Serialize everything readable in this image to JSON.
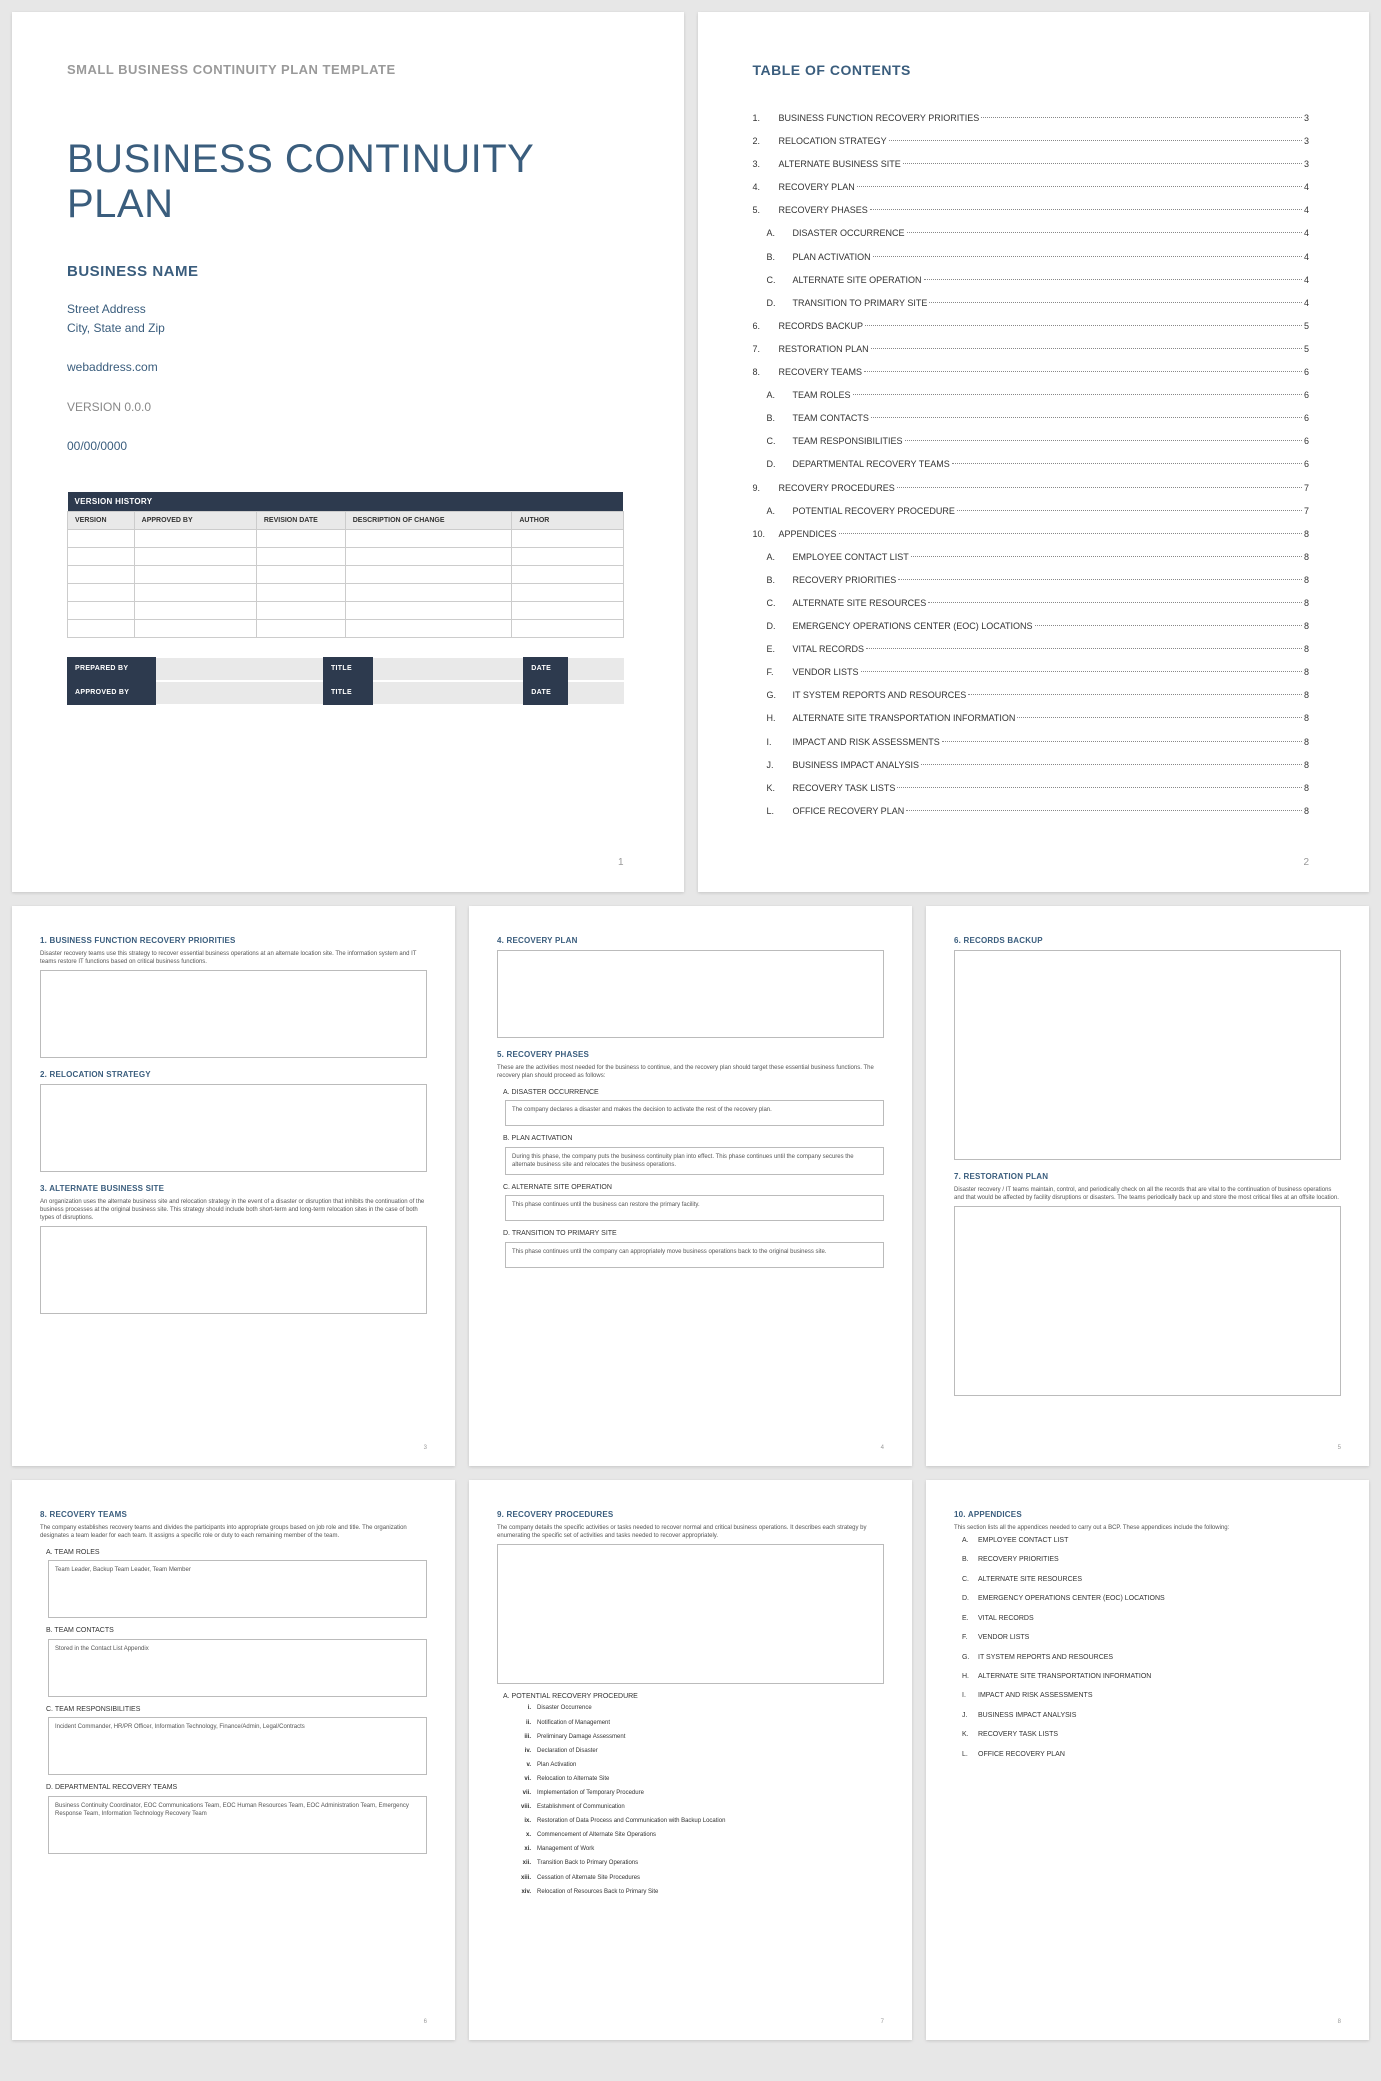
{
  "cover": {
    "template_label": "SMALL BUSINESS CONTINUITY PLAN TEMPLATE",
    "title": "BUSINESS CONTINUITY PLAN",
    "business_name": "BUSINESS NAME",
    "street": "Street Address",
    "city": "City, State and Zip",
    "web": "webaddress.com",
    "version": "VERSION 0.0.0",
    "date": "00/00/0000",
    "vh_header": "VERSION HISTORY",
    "vh_cols": [
      "VERSION",
      "APPROVED BY",
      "REVISION DATE",
      "DESCRIPTION OF CHANGE",
      "AUTHOR"
    ],
    "sign_rows": {
      "prepared": "PREPARED BY",
      "approved": "APPROVED BY",
      "title": "TITLE",
      "date": "DATE"
    },
    "page_num": "1"
  },
  "toc": {
    "title": "TABLE OF CONTENTS",
    "items": [
      {
        "num": "1.",
        "label": "BUSINESS FUNCTION RECOVERY PRIORITIES",
        "page": "3",
        "sub": false
      },
      {
        "num": "2.",
        "label": "RELOCATION STRATEGY",
        "page": "3",
        "sub": false
      },
      {
        "num": "3.",
        "label": "ALTERNATE BUSINESS SITE",
        "page": "3",
        "sub": false
      },
      {
        "num": "4.",
        "label": "RECOVERY PLAN",
        "page": "4",
        "sub": false
      },
      {
        "num": "5.",
        "label": "RECOVERY PHASES",
        "page": "4",
        "sub": false
      },
      {
        "num": "A.",
        "label": "DISASTER OCCURRENCE",
        "page": "4",
        "sub": true
      },
      {
        "num": "B.",
        "label": "PLAN ACTIVATION",
        "page": "4",
        "sub": true
      },
      {
        "num": "C.",
        "label": "ALTERNATE SITE OPERATION",
        "page": "4",
        "sub": true
      },
      {
        "num": "D.",
        "label": "TRANSITION TO PRIMARY SITE",
        "page": "4",
        "sub": true
      },
      {
        "num": "6.",
        "label": "RECORDS BACKUP",
        "page": "5",
        "sub": false
      },
      {
        "num": "7.",
        "label": "RESTORATION PLAN",
        "page": "5",
        "sub": false
      },
      {
        "num": "8.",
        "label": "RECOVERY TEAMS",
        "page": "6",
        "sub": false
      },
      {
        "num": "A.",
        "label": "TEAM ROLES",
        "page": "6",
        "sub": true
      },
      {
        "num": "B.",
        "label": "TEAM CONTACTS",
        "page": "6",
        "sub": true
      },
      {
        "num": "C.",
        "label": "TEAM RESPONSIBILITIES",
        "page": "6",
        "sub": true
      },
      {
        "num": "D.",
        "label": "DEPARTMENTAL RECOVERY TEAMS",
        "page": "6",
        "sub": true
      },
      {
        "num": "9.",
        "label": "RECOVERY PROCEDURES",
        "page": "7",
        "sub": false
      },
      {
        "num": "A.",
        "label": "POTENTIAL RECOVERY PROCEDURE",
        "page": "7",
        "sub": true
      },
      {
        "num": "10.",
        "label": "APPENDICES",
        "page": "8",
        "sub": false
      },
      {
        "num": "A.",
        "label": "EMPLOYEE CONTACT LIST",
        "page": "8",
        "sub": true
      },
      {
        "num": "B.",
        "label": "RECOVERY PRIORITIES",
        "page": "8",
        "sub": true
      },
      {
        "num": "C.",
        "label": "ALTERNATE SITE RESOURCES",
        "page": "8",
        "sub": true
      },
      {
        "num": "D.",
        "label": "EMERGENCY OPERATIONS CENTER (EOC) LOCATIONS",
        "page": "8",
        "sub": true
      },
      {
        "num": "E.",
        "label": "VITAL RECORDS",
        "page": "8",
        "sub": true
      },
      {
        "num": "F.",
        "label": "VENDOR LISTS",
        "page": "8",
        "sub": true
      },
      {
        "num": "G.",
        "label": "IT SYSTEM REPORTS AND RESOURCES",
        "page": "8",
        "sub": true
      },
      {
        "num": "H.",
        "label": "ALTERNATE SITE TRANSPORTATION INFORMATION",
        "page": "8",
        "sub": true
      },
      {
        "num": "I.",
        "label": "IMPACT AND RISK ASSESSMENTS",
        "page": "8",
        "sub": true
      },
      {
        "num": "J.",
        "label": "BUSINESS IMPACT ANALYSIS",
        "page": "8",
        "sub": true
      },
      {
        "num": "K.",
        "label": "RECOVERY TASK LISTS",
        "page": "8",
        "sub": true
      },
      {
        "num": "L.",
        "label": "OFFICE RECOVERY PLAN",
        "page": "8",
        "sub": true
      }
    ],
    "page_num": "2"
  },
  "p3": {
    "s1_title": "1. BUSINESS FUNCTION RECOVERY PRIORITIES",
    "s1_desc": "Disaster recovery teams use this strategy to recover essential business operations at an alternate location site. The information system and IT teams restore IT functions based on critical business functions.",
    "s2_title": "2. RELOCATION STRATEGY",
    "s3_title": "3. ALTERNATE BUSINESS SITE",
    "s3_desc": "An organization uses the alternate business site and relocation strategy in the event of a disaster or disruption that inhibits the continuation of the business processes at the original business site. This strategy should include both short-term and long-term relocation sites in the case of both types of disruptions.",
    "page_num": "3"
  },
  "p4": {
    "s4_title": "4. RECOVERY PLAN",
    "s5_title": "5. RECOVERY PHASES",
    "s5_desc": "These are the activities most needed for the business to continue, and the recovery plan should target these essential business functions. The recovery plan should proceed as follows:",
    "a_title": "A. DISASTER OCCURRENCE",
    "a_box": "The company declares a disaster and makes the decision to activate the rest of the recovery plan.",
    "b_title": "B. PLAN ACTIVATION",
    "b_box": "During this phase, the company puts the business continuity plan into effect. This phase continues until the company secures the alternate business site and relocates the business operations.",
    "c_title": "C. ALTERNATE SITE OPERATION",
    "c_box": "This phase continues until the business can restore the primary facility.",
    "d_title": "D. TRANSITION TO PRIMARY SITE",
    "d_box": "This phase continues until the company can appropriately move business operations back to the original business site.",
    "page_num": "4"
  },
  "p5": {
    "s6_title": "6. RECORDS BACKUP",
    "s7_title": "7. RESTORATION PLAN",
    "s7_desc": "Disaster recovery / IT teams maintain, control, and periodically check on all the records that are vital to the continuation of business operations and that would be affected by facility disruptions or disasters. The teams periodically back up and store the most critical files at an offsite location.",
    "page_num": "5"
  },
  "p6": {
    "s8_title": "8. RECOVERY TEAMS",
    "s8_desc": "The company establishes recovery teams and divides the participants into appropriate groups based on job role and title. The organization designates a team leader for each team. It assigns a specific role or duty to each remaining member of the team.",
    "a_title": "A. TEAM ROLES",
    "a_box": "Team Leader, Backup Team Leader, Team Member",
    "b_title": "B. TEAM CONTACTS",
    "b_box": "Stored in the Contact List Appendix",
    "c_title": "C. TEAM RESPONSIBILITIES",
    "c_box": "Incident Commander, HR/PR Officer, Information Technology, Finance/Admin, Legal/Contracts",
    "d_title": "D. DEPARTMENTAL RECOVERY TEAMS",
    "d_box": "Business Continuity Coordinator, EOC Communications Team, EOC Human Resources Team, EOC Administration Team, Emergency Response Team, Information Technology Recovery Team",
    "page_num": "6"
  },
  "p7": {
    "s9_title": "9. RECOVERY PROCEDURES",
    "s9_desc": "The company details the specific activities or tasks needed to recover normal and critical business operations. It describes each strategy by enumerating the specific set of activities and tasks needed to recover appropriately.",
    "a_title": "A. POTENTIAL RECOVERY PROCEDURE",
    "steps": [
      {
        "rn": "i.",
        "t": "Disaster Occurrence"
      },
      {
        "rn": "ii.",
        "t": "Notification of Management"
      },
      {
        "rn": "iii.",
        "t": "Preliminary Damage Assessment"
      },
      {
        "rn": "iv.",
        "t": "Declaration of Disaster"
      },
      {
        "rn": "v.",
        "t": "Plan Activation"
      },
      {
        "rn": "vi.",
        "t": "Relocation to Alternate Site"
      },
      {
        "rn": "vii.",
        "t": "Implementation of Temporary Procedure"
      },
      {
        "rn": "viii.",
        "t": "Establishment of Communication"
      },
      {
        "rn": "ix.",
        "t": "Restoration of Data Process and Communication with Backup Location"
      },
      {
        "rn": "x.",
        "t": "Commencement of Alternate Site Operations"
      },
      {
        "rn": "xi.",
        "t": "Management of Work"
      },
      {
        "rn": "xii.",
        "t": "Transition Back to Primary Operations"
      },
      {
        "rn": "xiii.",
        "t": "Cessation of Alternate Site Procedures"
      },
      {
        "rn": "xiv.",
        "t": "Relocation of Resources Back to Primary Site"
      }
    ],
    "page_num": "7"
  },
  "p8": {
    "s10_title": "10.   APPENDICES",
    "s10_desc": "This section lists all the appendices needed to carry out a BCP. These appendices include the following:",
    "items": [
      {
        "rn": "A.",
        "t": "EMPLOYEE CONTACT LIST"
      },
      {
        "rn": "B.",
        "t": "RECOVERY PRIORITIES"
      },
      {
        "rn": "C.",
        "t": "ALTERNATE SITE RESOURCES"
      },
      {
        "rn": "D.",
        "t": "EMERGENCY OPERATIONS CENTER (EOC) LOCATIONS"
      },
      {
        "rn": "E.",
        "t": "VITAL RECORDS"
      },
      {
        "rn": "F.",
        "t": "VENDOR LISTS"
      },
      {
        "rn": "G.",
        "t": "IT SYSTEM REPORTS AND RESOURCES"
      },
      {
        "rn": "H.",
        "t": "ALTERNATE SITE TRANSPORTATION INFORMATION"
      },
      {
        "rn": "I.",
        "t": "IMPACT AND RISK ASSESSMENTS"
      },
      {
        "rn": "J.",
        "t": "BUSINESS IMPACT ANALYSIS"
      },
      {
        "rn": "K.",
        "t": "RECOVERY TASK LISTS"
      },
      {
        "rn": "L.",
        "t": "OFFICE RECOVERY PLAN"
      }
    ],
    "page_num": "8"
  }
}
